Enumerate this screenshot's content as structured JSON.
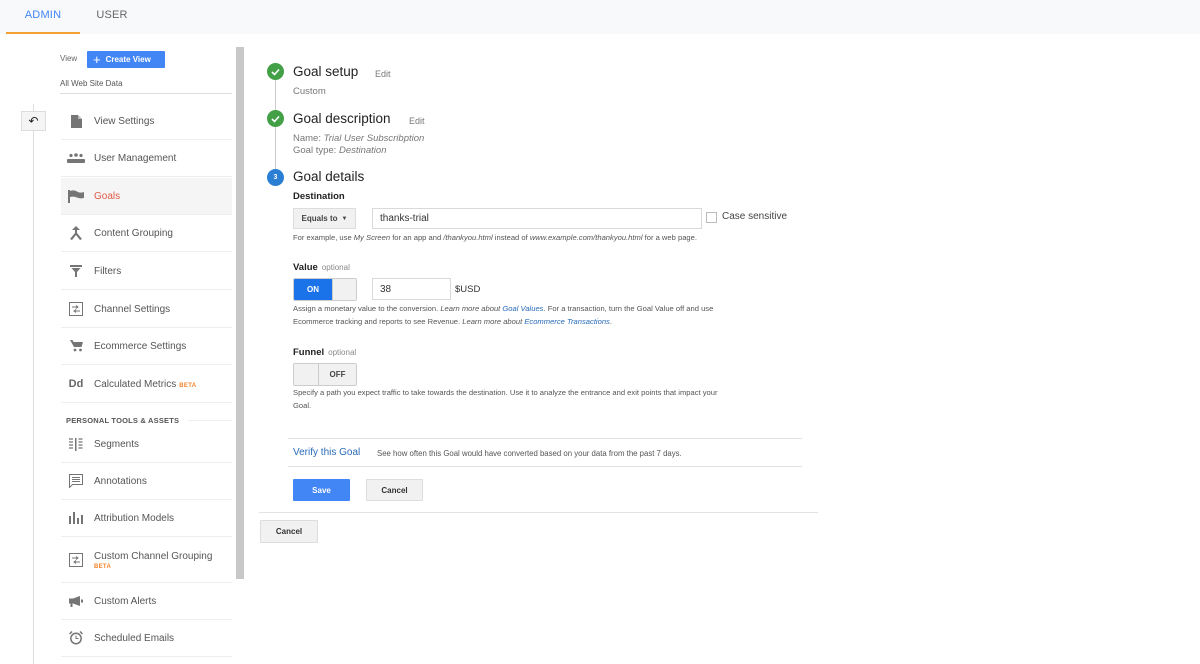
{
  "tabs": [
    {
      "label": "ADMIN",
      "active": true
    },
    {
      "label": "USER",
      "active": false
    }
  ],
  "sidebar": {
    "view_label": "View",
    "create_view_label": "Create View",
    "view_name": "All Web Site Data",
    "items": [
      {
        "label": "View Settings",
        "icon": "document-icon"
      },
      {
        "label": "User Management",
        "icon": "users-icon"
      },
      {
        "label": "Goals",
        "icon": "flag-icon",
        "active": true
      },
      {
        "label": "Content Grouping",
        "icon": "content-grouping-icon"
      },
      {
        "label": "Filters",
        "icon": "filter-icon"
      },
      {
        "label": "Channel Settings",
        "icon": "channel-settings-icon"
      },
      {
        "label": "Ecommerce Settings",
        "icon": "cart-icon"
      },
      {
        "label": "Calculated Metrics",
        "icon": "dd-icon",
        "badge": "BETA"
      }
    ],
    "section_title": "PERSONAL TOOLS & ASSETS",
    "personal_items": [
      {
        "label": "Segments",
        "icon": "segments-icon"
      },
      {
        "label": "Annotations",
        "icon": "annotation-icon"
      },
      {
        "label": "Attribution Models",
        "icon": "bar-chart-icon"
      },
      {
        "label": "Custom Channel Grouping",
        "icon": "channel-grouping-icon",
        "badge": "BETA"
      },
      {
        "label": "Custom Alerts",
        "icon": "megaphone-icon"
      },
      {
        "label": "Scheduled Emails",
        "icon": "alarm-clock-icon"
      }
    ],
    "dd_glyph": "Dd"
  },
  "steps": {
    "setup": {
      "title": "Goal setup",
      "edit": "Edit",
      "sub": "Custom"
    },
    "description": {
      "title": "Goal description",
      "edit": "Edit",
      "name_label": "Name:",
      "name_value": "Trial User Subscribption",
      "type_label": "Goal type:",
      "type_value": "Destination"
    },
    "details": {
      "number": "3",
      "title": "Goal details"
    }
  },
  "destination": {
    "label": "Destination",
    "match_type": "Equals to",
    "value": "thanks-trial",
    "case_sensitive_label": "Case sensitive",
    "case_sensitive": false,
    "help": {
      "t1": "For example, use ",
      "i1": "My Screen",
      "t2": " for an app and ",
      "i2": "/thankyou.html",
      "t3": " instead of ",
      "i3": "www.example.com/thankyou.html",
      "t4": " for a web page."
    }
  },
  "value": {
    "label": "Value",
    "optional": "optional",
    "toggle": "ON",
    "amount": "38",
    "currency": "$USD",
    "help": {
      "t1": "Assign a monetary value to the conversion. ",
      "i1": "Learn more about ",
      "link1": "Goal Values",
      "t2": ". For a transaction, turn the Goal Value off and use",
      "t3": "Ecommerce tracking and reports to see Revenue. ",
      "i2": "Learn more about ",
      "link2": "Ecommerce Transactions",
      "t4": "."
    }
  },
  "funnel": {
    "label": "Funnel",
    "optional": "optional",
    "toggle": "OFF",
    "help_line1": "Specify a path you expect traffic to take towards the destination. Use it to analyze the entrance and exit points that impact your",
    "help_line2": "Goal."
  },
  "verify": {
    "link": "Verify this Goal",
    "desc": "See how often this Goal would have converted based on your data from the past 7 days."
  },
  "buttons": {
    "save": "Save",
    "cancel": "Cancel",
    "outer_cancel": "Cancel"
  }
}
